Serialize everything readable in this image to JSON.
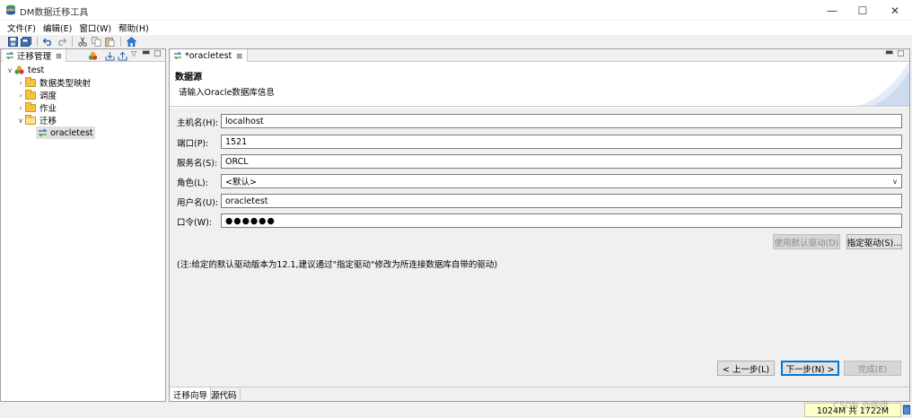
{
  "app": {
    "title": "DM数据迁移工具",
    "window_controls": [
      "minimize-icon",
      "maximize-icon",
      "close-icon"
    ]
  },
  "menu": [
    "文件(F)",
    "编辑(E)",
    "窗口(W)",
    "帮助(H)"
  ],
  "toolbar_icons": [
    "save-icon",
    "save-all-icon",
    "undo-icon",
    "redo-icon",
    "cut-icon",
    "copy-icon",
    "paste-icon",
    "home-icon"
  ],
  "left_panel": {
    "tab_label": "迁移管理",
    "tab_close": "⊠",
    "view_icons": [
      "palette-icon",
      "import-icon",
      "export-icon",
      "view-menu-icon",
      "minimize-view-icon",
      "maximize-view-icon"
    ],
    "tree": {
      "root": "test",
      "children": [
        "数据类型映射",
        "调度",
        "作业",
        "迁移"
      ],
      "migration_item": "oracletest"
    }
  },
  "editor": {
    "tab_label": "*oracletest",
    "tab_close": "⊠",
    "wizard_title": "数据源",
    "wizard_desc": "请输入Oracle数据库信息",
    "fields": {
      "host_label": "主机名(H):",
      "host_value": "localhost",
      "port_label": "端口(P):",
      "port_value": "1521",
      "service_label": "服务名(S):",
      "service_value": "ORCL",
      "role_label": "角色(L):",
      "role_value": "<默认>",
      "user_label": "用户名(U):",
      "user_value": "oracletest",
      "password_label": "口令(W):",
      "password_value": "●●●●●●"
    },
    "buttons": {
      "use_default_driver": "使用默认驱动(D)",
      "specify_driver": "指定驱动(S)..."
    },
    "note": "(注:给定的默认驱动版本为12.1,建议通过\"指定驱动\"修改为所连接数据库自带的驱动)",
    "nav": {
      "back": "< 上一步(L)",
      "next": "下一步(N) >",
      "finish": "完成(E)"
    },
    "bottom_tabs": [
      "迁移向导",
      "源代码"
    ]
  },
  "status": {
    "memory": "1024M 共 1722M"
  },
  "watermark": "CSDN @咖啡"
}
